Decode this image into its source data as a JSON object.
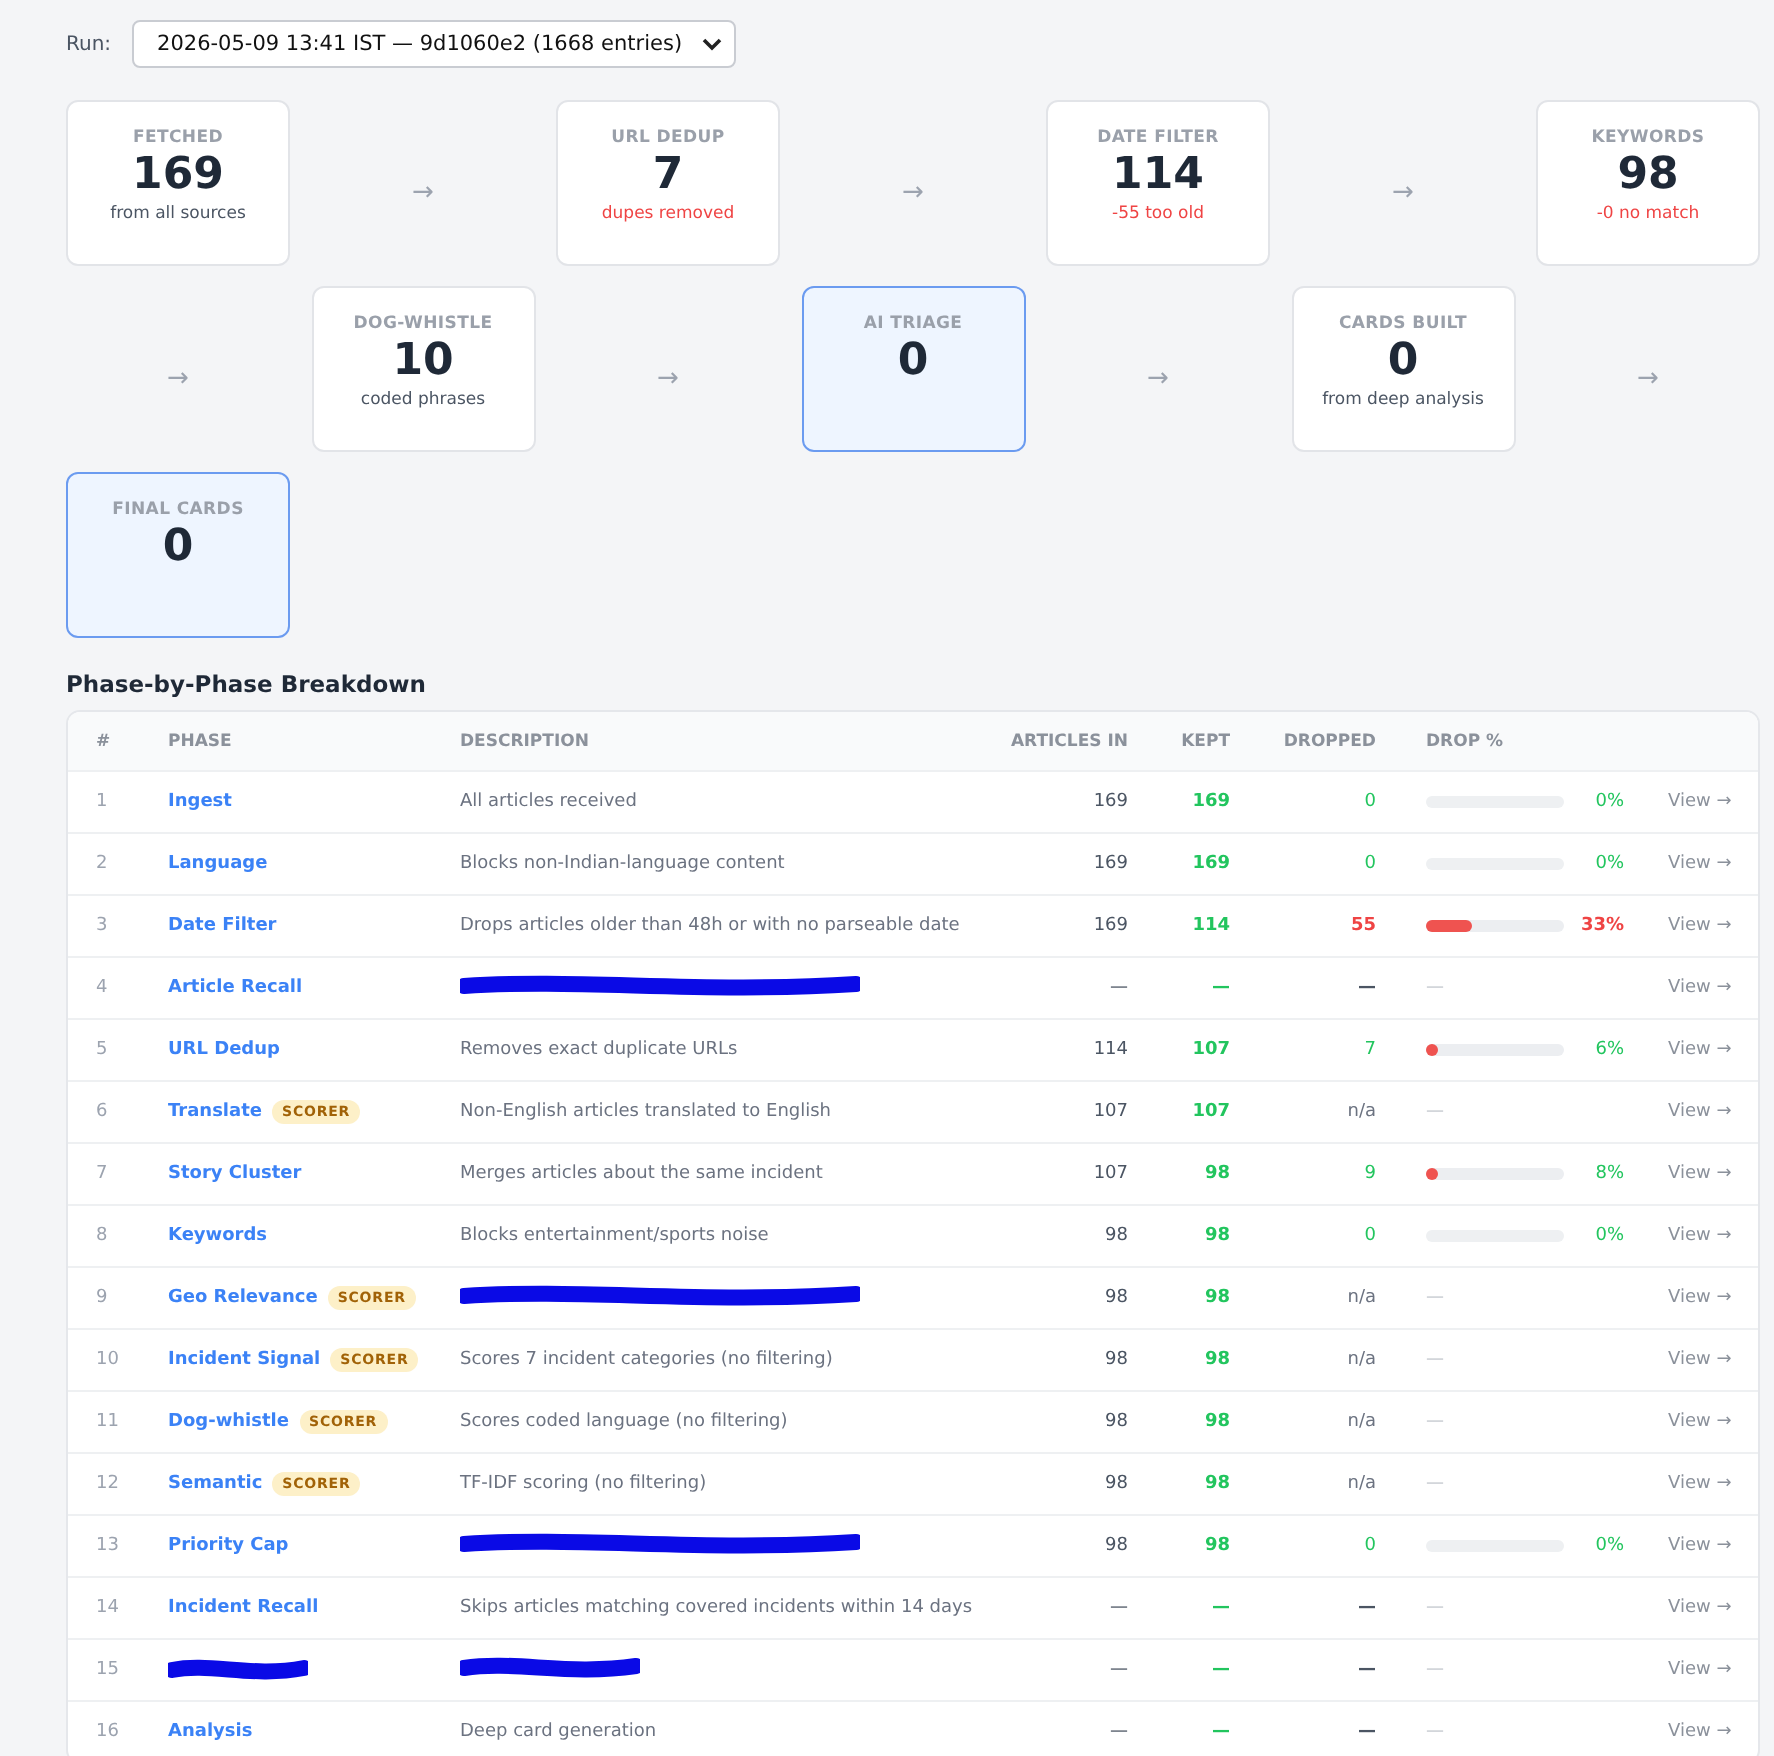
{
  "run_selector": {
    "label": "Run:",
    "value": "2026-05-09 13:41 IST — 9d1060e2 (1668 entries)"
  },
  "pipeline": [
    {
      "kind": "stage",
      "label": "FETCHED",
      "value": "169",
      "note": "from all sources",
      "note_alert": false,
      "highlighted": false
    },
    {
      "kind": "arrow",
      "text": "→"
    },
    {
      "kind": "stage",
      "label": "URL DEDUP",
      "value": "7",
      "note": "dupes removed",
      "note_alert": true,
      "highlighted": false
    },
    {
      "kind": "arrow",
      "text": "→"
    },
    {
      "kind": "stage",
      "label": "DATE FILTER",
      "value": "114",
      "note": "-55 too old",
      "note_alert": true,
      "highlighted": false
    },
    {
      "kind": "arrow",
      "text": "→"
    },
    {
      "kind": "stage",
      "label": "KEYWORDS",
      "value": "98",
      "note": "-0 no match",
      "note_alert": true,
      "highlighted": false
    },
    {
      "kind": "arrow",
      "text": "→"
    },
    {
      "kind": "stage",
      "label": "DOG-WHISTLE",
      "value": "10",
      "note": "coded phrases",
      "note_alert": false,
      "highlighted": false
    },
    {
      "kind": "arrow",
      "text": "→"
    },
    {
      "kind": "stage",
      "label": "AI TRIAGE",
      "value": "0",
      "highlighted": true
    },
    {
      "kind": "arrow",
      "text": "→"
    },
    {
      "kind": "stage",
      "label": "CARDS BUILT",
      "value": "0",
      "note": "from deep analysis",
      "note_alert": false,
      "highlighted": false
    },
    {
      "kind": "arrow",
      "text": "→"
    },
    {
      "kind": "stage",
      "label": "FINAL CARDS",
      "value": "0",
      "highlighted": true
    }
  ],
  "breakdown": {
    "title": "Phase-by-Phase Breakdown",
    "columns": [
      "#",
      "PHASE",
      "DESCRIPTION",
      "ARTICLES IN",
      "KEPT",
      "DROPPED",
      "DROP %"
    ],
    "rows": [
      {
        "number": "1",
        "phase": "Ingest",
        "description": "All articles received",
        "articles_in": "169",
        "kept": "169",
        "dropped": {
          "kind": "ok",
          "text": "0"
        },
        "drop": {
          "kind": "bar",
          "level": 0,
          "reading": "0%",
          "alert": false
        },
        "action": "View →"
      },
      {
        "number": "2",
        "phase": "Language",
        "description": "Blocks non-Indian-language content",
        "articles_in": "169",
        "kept": "169",
        "dropped": {
          "kind": "ok",
          "text": "0"
        },
        "drop": {
          "kind": "bar",
          "level": 0,
          "reading": "0%",
          "alert": false
        },
        "action": "View →"
      },
      {
        "number": "3",
        "phase": "Date Filter",
        "description": "Drops articles older than 48h or with no parseable date",
        "articles_in": "169",
        "kept": "114",
        "dropped": {
          "kind": "alert",
          "text": "55"
        },
        "drop": {
          "kind": "bar",
          "level": 0.33,
          "reading": "33%",
          "alert": true
        },
        "action": "View →"
      },
      {
        "number": "4",
        "phase": "Article Recall",
        "description_redacted": true,
        "articles_in": "—",
        "kept": "—",
        "dropped": {
          "kind": "none",
          "text": "—"
        },
        "drop": {
          "kind": "none",
          "text": "—"
        },
        "action": "View →"
      },
      {
        "number": "5",
        "phase": "URL Dedup",
        "description": "Removes exact duplicate URLs",
        "articles_in": "114",
        "kept": "107",
        "dropped": {
          "kind": "ok",
          "text": "7"
        },
        "drop": {
          "kind": "bar",
          "level": 0.06,
          "reading": "6%",
          "alert": false
        },
        "action": "View →"
      },
      {
        "number": "6",
        "phase": "Translate",
        "badge": "SCORER",
        "description": "Non-English articles translated to English",
        "articles_in": "107",
        "kept": "107",
        "dropped": {
          "kind": "muted",
          "text": "n/a"
        },
        "drop": {
          "kind": "none",
          "text": "—"
        },
        "action": "View →"
      },
      {
        "number": "7",
        "phase": "Story Cluster",
        "description": "Merges articles about the same incident",
        "articles_in": "107",
        "kept": "98",
        "dropped": {
          "kind": "ok",
          "text": "9"
        },
        "drop": {
          "kind": "bar",
          "level": 0.08,
          "reading": "8%",
          "alert": false
        },
        "action": "View →"
      },
      {
        "number": "8",
        "phase": "Keywords",
        "description": "Blocks entertainment/sports noise",
        "articles_in": "98",
        "kept": "98",
        "dropped": {
          "kind": "ok",
          "text": "0"
        },
        "drop": {
          "kind": "bar",
          "level": 0,
          "reading": "0%",
          "alert": false
        },
        "action": "View →"
      },
      {
        "number": "9",
        "phase": "Geo Relevance",
        "badge": "SCORER",
        "description_redacted": true,
        "articles_in": "98",
        "kept": "98",
        "dropped": {
          "kind": "muted",
          "text": "n/a"
        },
        "drop": {
          "kind": "none",
          "text": "—"
        },
        "action": "View →"
      },
      {
        "number": "10",
        "phase": "Incident Signal",
        "badge": "SCORER",
        "description": "Scores 7 incident categories (no filtering)",
        "articles_in": "98",
        "kept": "98",
        "dropped": {
          "kind": "muted",
          "text": "n/a"
        },
        "drop": {
          "kind": "none",
          "text": "—"
        },
        "action": "View →"
      },
      {
        "number": "11",
        "phase": "Dog-whistle",
        "badge": "SCORER",
        "description": "Scores coded language (no filtering)",
        "articles_in": "98",
        "kept": "98",
        "dropped": {
          "kind": "muted",
          "text": "n/a"
        },
        "drop": {
          "kind": "none",
          "text": "—"
        },
        "action": "View →"
      },
      {
        "number": "12",
        "phase": "Semantic",
        "badge": "SCORER",
        "description": "TF-IDF scoring (no filtering)",
        "articles_in": "98",
        "kept": "98",
        "dropped": {
          "kind": "muted",
          "text": "n/a"
        },
        "drop": {
          "kind": "none",
          "text": "—"
        },
        "action": "View →"
      },
      {
        "number": "13",
        "phase": "Priority Cap",
        "description_redacted": true,
        "articles_in": "98",
        "kept": "98",
        "dropped": {
          "kind": "ok",
          "text": "0"
        },
        "drop": {
          "kind": "bar",
          "level": 0,
          "reading": "0%",
          "alert": false
        },
        "action": "View →"
      },
      {
        "number": "14",
        "phase": "Incident Recall",
        "description": "Skips articles matching covered incidents within 14 days",
        "articles_in": "—",
        "kept": "—",
        "dropped": {
          "kind": "none",
          "text": "—"
        },
        "drop": {
          "kind": "none",
          "text": "—"
        },
        "action": "View →"
      },
      {
        "number": "15",
        "phase_redacted": true,
        "description_redacted": true,
        "articles_in": "—",
        "kept": "—",
        "dropped": {
          "kind": "none",
          "text": "—"
        },
        "drop": {
          "kind": "none",
          "text": "—"
        },
        "action": "View →"
      },
      {
        "number": "16",
        "phase": "Analysis",
        "description": "Deep card generation",
        "articles_in": "—",
        "kept": "—",
        "dropped": {
          "kind": "none",
          "text": "—"
        },
        "drop": {
          "kind": "none",
          "text": "—"
        },
        "action": "View →"
      }
    ]
  }
}
